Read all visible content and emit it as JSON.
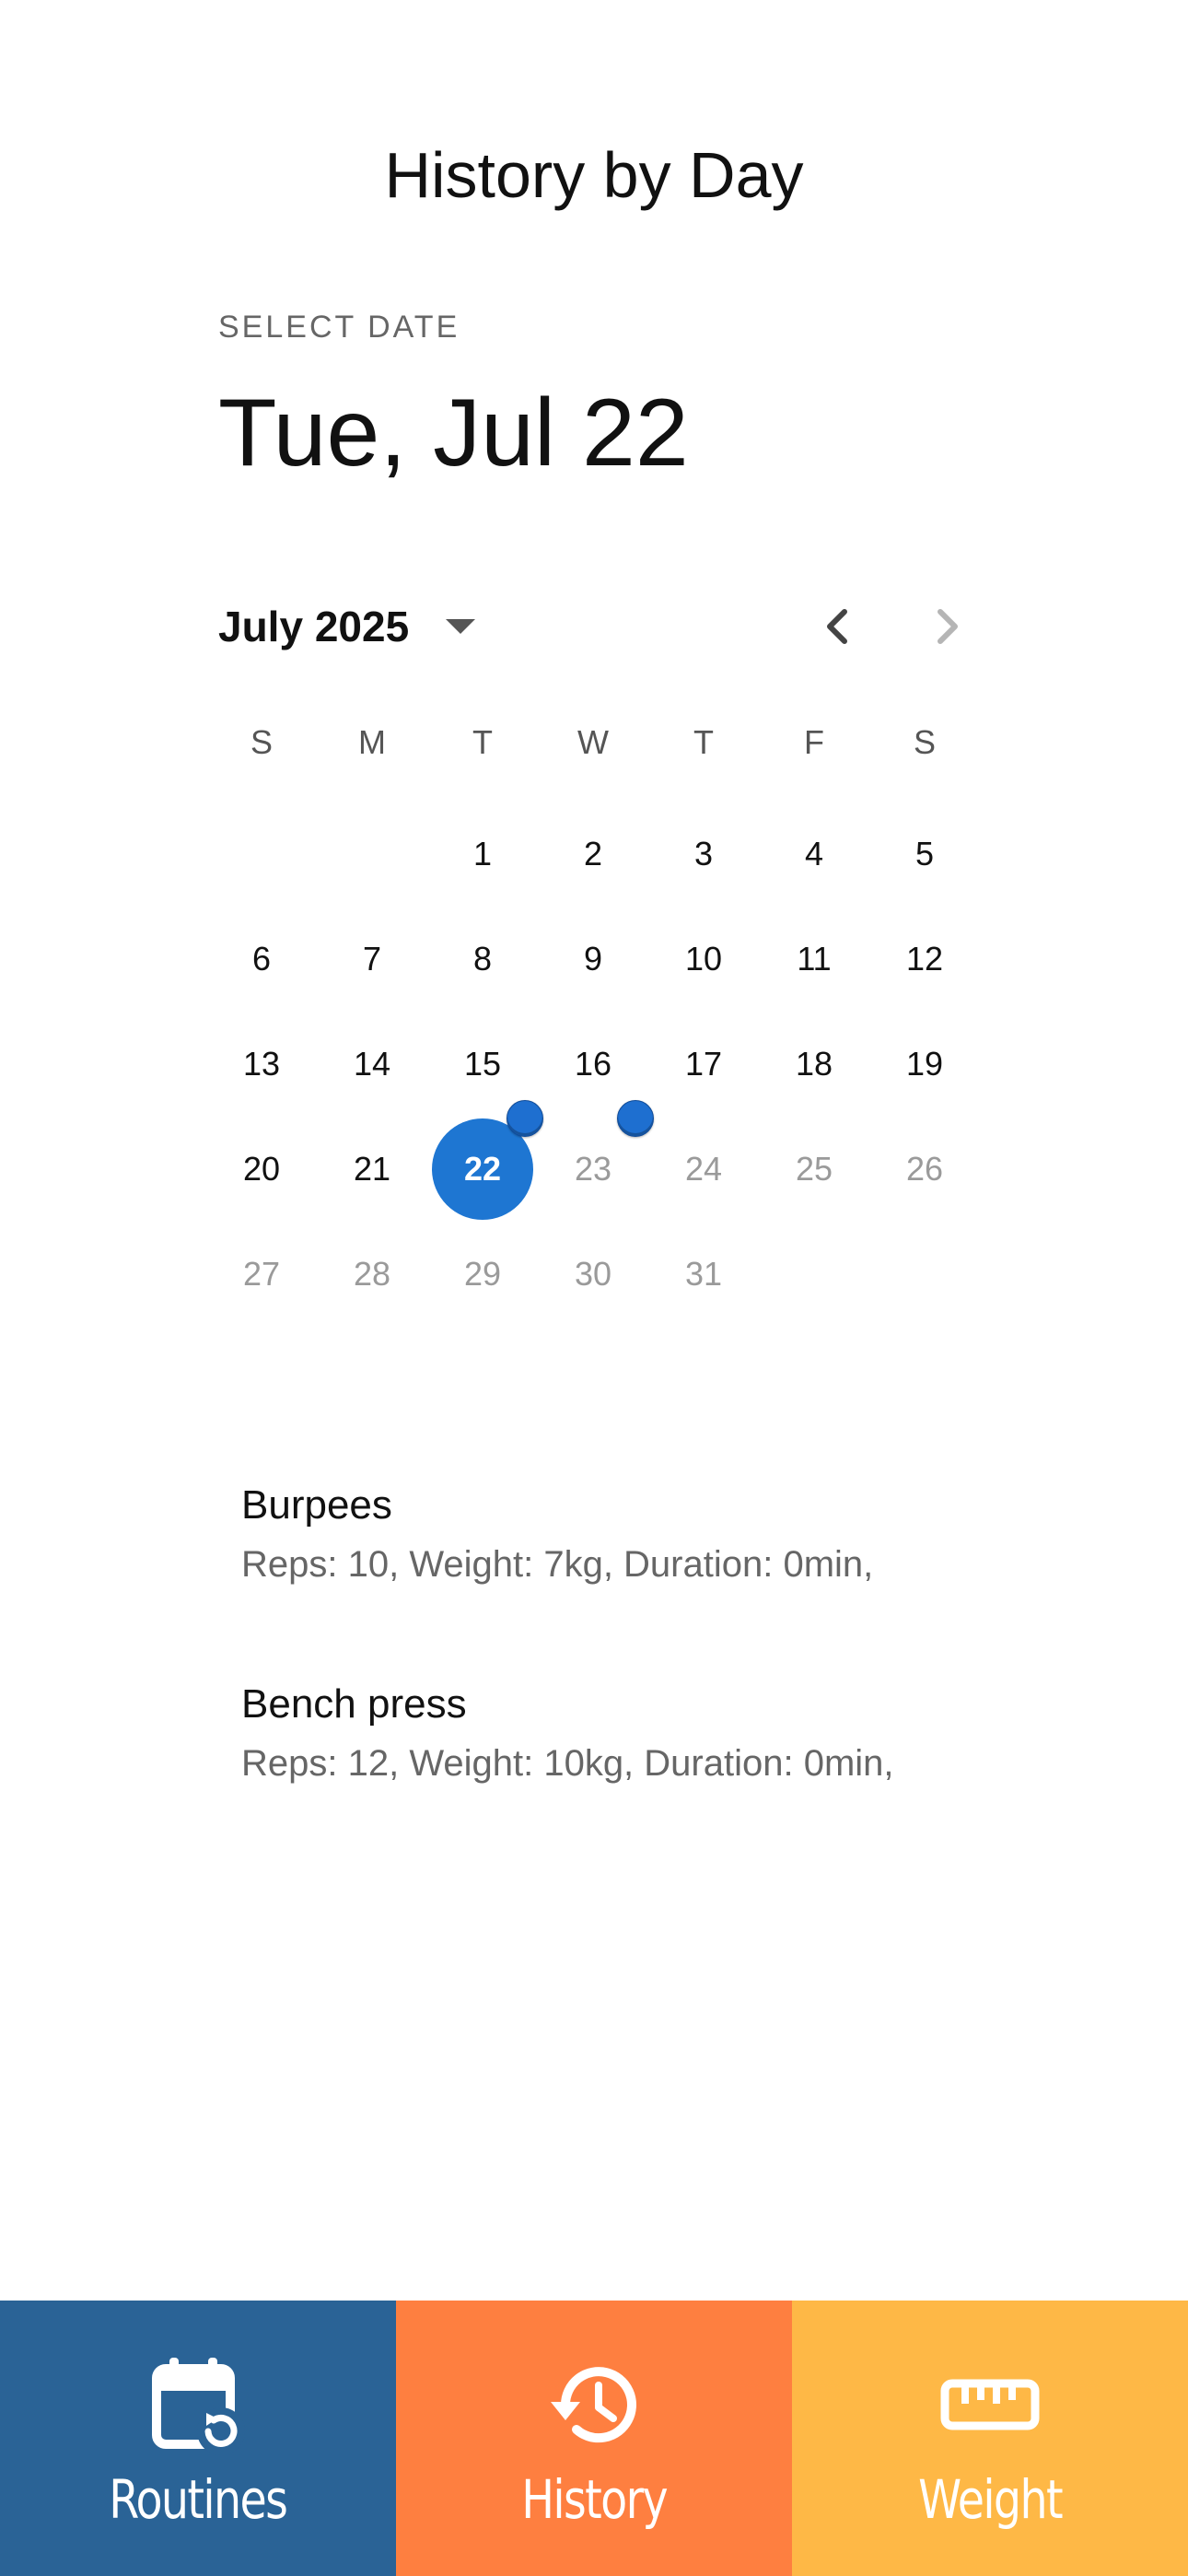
{
  "header": {
    "title": "History by Day"
  },
  "picker": {
    "select_label": "SELECT DATE",
    "selected_date": "Tue, Jul 22",
    "month_label": "July 2025",
    "weekdays": [
      "S",
      "M",
      "T",
      "W",
      "T",
      "F",
      "S"
    ],
    "days": [
      {
        "label": "1",
        "state": "enabled"
      },
      {
        "label": "2",
        "state": "enabled"
      },
      {
        "label": "3",
        "state": "enabled"
      },
      {
        "label": "4",
        "state": "enabled"
      },
      {
        "label": "5",
        "state": "enabled"
      },
      {
        "label": "6",
        "state": "enabled"
      },
      {
        "label": "7",
        "state": "enabled"
      },
      {
        "label": "8",
        "state": "enabled"
      },
      {
        "label": "9",
        "state": "enabled"
      },
      {
        "label": "10",
        "state": "enabled"
      },
      {
        "label": "11",
        "state": "enabled"
      },
      {
        "label": "12",
        "state": "enabled"
      },
      {
        "label": "13",
        "state": "enabled"
      },
      {
        "label": "14",
        "state": "enabled"
      },
      {
        "label": "15",
        "state": "enabled"
      },
      {
        "label": "16",
        "state": "enabled"
      },
      {
        "label": "17",
        "state": "enabled"
      },
      {
        "label": "18",
        "state": "enabled"
      },
      {
        "label": "19",
        "state": "enabled"
      },
      {
        "label": "20",
        "state": "enabled"
      },
      {
        "label": "21",
        "state": "enabled"
      },
      {
        "label": "22",
        "state": "selected"
      },
      {
        "label": "23",
        "state": "disabled"
      },
      {
        "label": "24",
        "state": "disabled"
      },
      {
        "label": "25",
        "state": "disabled"
      },
      {
        "label": "26",
        "state": "disabled"
      },
      {
        "label": "27",
        "state": "disabled"
      },
      {
        "label": "28",
        "state": "disabled"
      },
      {
        "label": "29",
        "state": "disabled"
      },
      {
        "label": "30",
        "state": "disabled"
      },
      {
        "label": "31",
        "state": "disabled"
      }
    ],
    "marked_days": [
      "22",
      "23"
    ],
    "colors": {
      "selected": "#1e76d2",
      "marker": "#1e6fd0"
    }
  },
  "entries": [
    {
      "name": "Burpees",
      "details": "Reps: 10, Weight: 7kg, Duration: 0min,"
    },
    {
      "name": "Bench press",
      "details": "Reps: 12, Weight: 10kg, Duration: 0min,"
    }
  ],
  "bottom_nav": [
    {
      "label": "Routines",
      "icon": "calendar-repeat-icon",
      "color": "#2a6396"
    },
    {
      "label": "History",
      "icon": "history-icon",
      "color": "#fe7f40"
    },
    {
      "label": "Weight",
      "icon": "ruler-icon",
      "color": "#feb846"
    }
  ]
}
